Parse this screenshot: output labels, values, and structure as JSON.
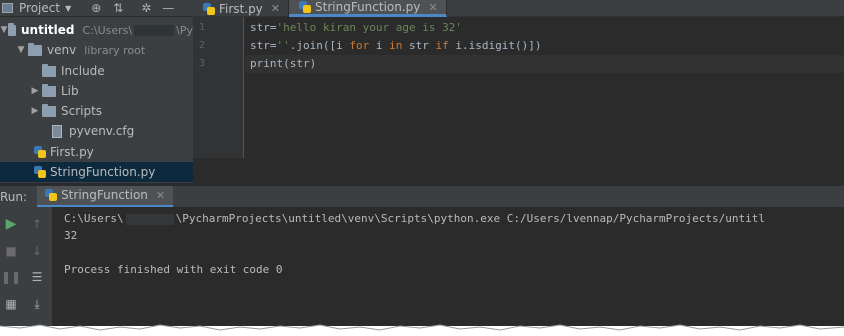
{
  "project_bar": {
    "title": "Project",
    "icons": [
      "caret-down-icon",
      "target-icon",
      "collapse-icon",
      "gear-icon",
      "hide-icon"
    ]
  },
  "tabs": [
    {
      "label": "First.py",
      "active": false
    },
    {
      "label": "StringFunction.py",
      "active": true
    }
  ],
  "tree": {
    "root": {
      "name": "untitled",
      "path_prefix": "C:\\Users\\",
      "path_suffix": "\\Py"
    },
    "venv": {
      "name": "venv",
      "note": "library root"
    },
    "include": "Include",
    "lib": "Lib",
    "scripts": "Scripts",
    "cfg": "pyvenv.cfg",
    "first": "First.py",
    "stringfunction": "StringFunction.py"
  },
  "editor": {
    "line_numbers": [
      "1",
      "2",
      "3"
    ],
    "lines": [
      {
        "a": "str=",
        "b": "'hello kiran your age is 32'"
      },
      {
        "a": "str=",
        "b": "''",
        "c": ".join([i ",
        "kw1": "for",
        "d": " i ",
        "kw2": "in",
        "e": " str ",
        "kw3": "if",
        "f": " i.isdigit()])"
      },
      {
        "a": "print",
        "b": "(str)"
      }
    ]
  },
  "run": {
    "label": "Run:",
    "tab": "StringFunction",
    "console": {
      "cmd_prefix": "C:\\Users\\",
      "cmd_suffix": "\\PycharmProjects\\untitled\\venv\\Scripts\\python.exe C:/Users/lvennap/PycharmProjects/untitl",
      "output": "32",
      "finished": "Process finished with exit code 0"
    }
  },
  "colors": {
    "background": "#2b2b2b",
    "panel": "#3c3f41",
    "accent": "#4a88c7",
    "string": "#6a8759",
    "keyword": "#cc7832",
    "run_green": "#59a869"
  }
}
